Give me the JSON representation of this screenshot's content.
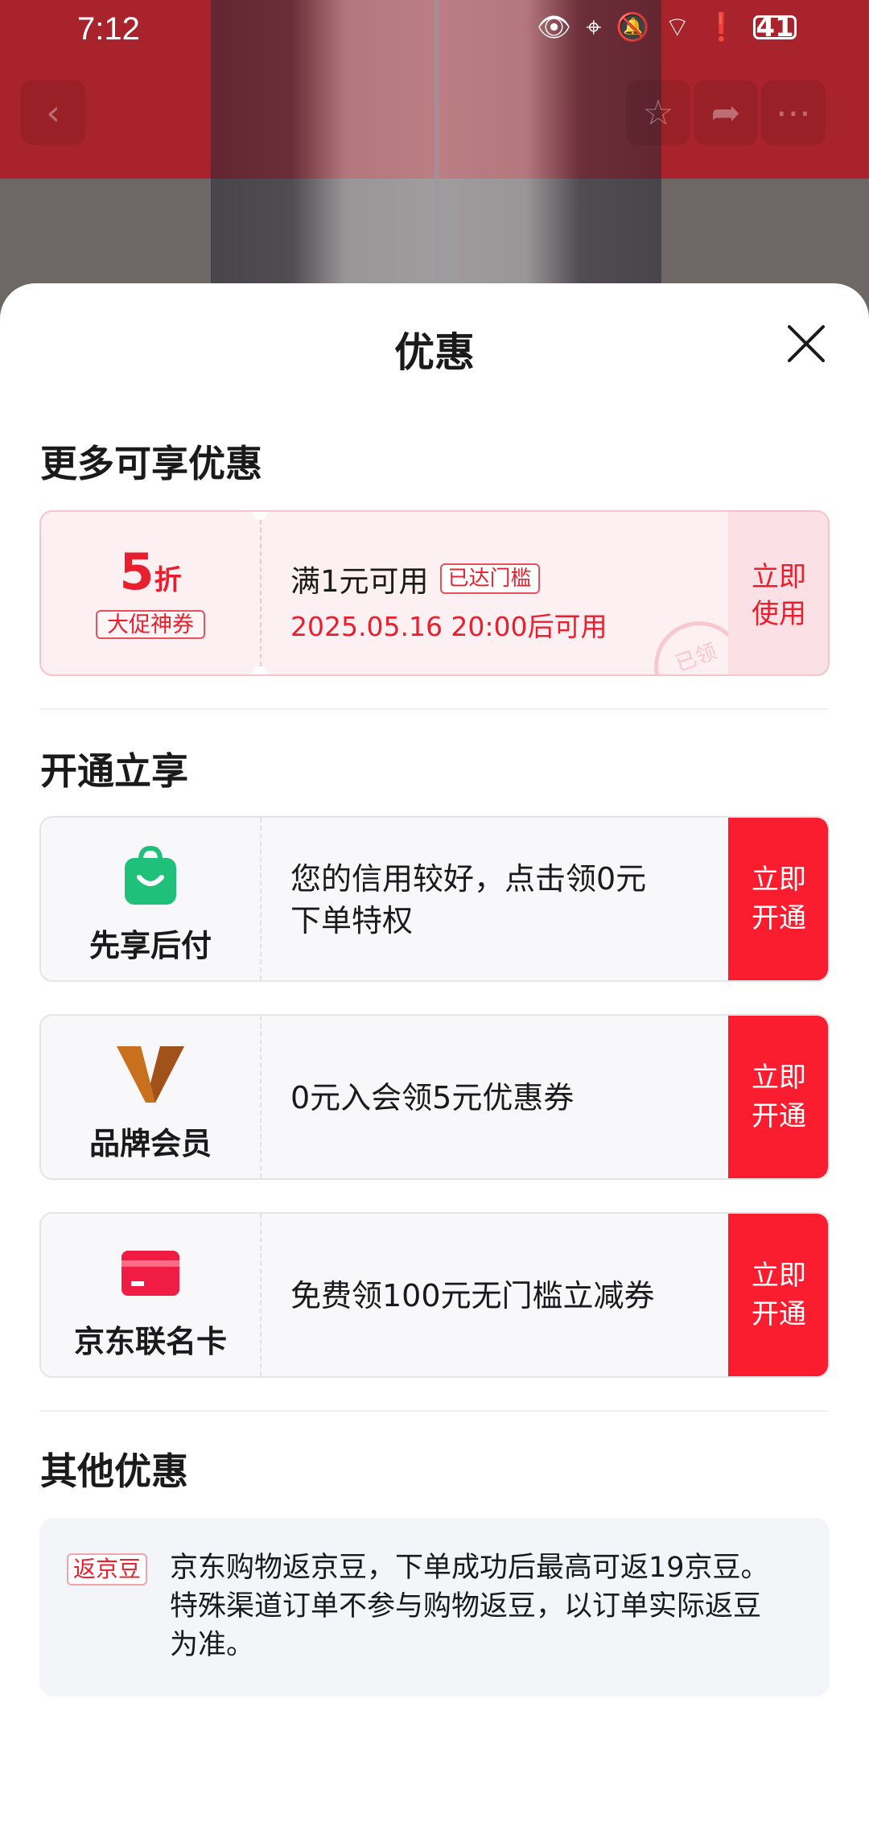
{
  "status_bar": {
    "time": "7:12",
    "battery": "41",
    "icons": [
      "eye-icon",
      "location-icon",
      "bell-off-icon",
      "wifi-icon",
      "alert-icon",
      "battery-icon"
    ]
  },
  "sheet": {
    "title": "优惠",
    "close_icon": "close-icon"
  },
  "section_more": {
    "title": "更多可享优惠",
    "coupon": {
      "value": "5",
      "unit": "折",
      "tag": "大促神券",
      "condition": "满1元可用",
      "badge": "已达门槛",
      "date": "2025.05.16 20:00后可用",
      "action_line1": "立即",
      "action_line2": "使用",
      "stamp": "已领",
      "accent_color": "#e8202e"
    }
  },
  "section_open": {
    "title": "开通立享",
    "items": [
      {
        "name": "先享后付",
        "icon": "shopping-bag-icon",
        "desc_line1": "您的信用较好，点击领0元",
        "desc_line2": "下单特权",
        "btn_line1": "立即",
        "btn_line2": "开通"
      },
      {
        "name": "品牌会员",
        "icon": "brand-v-icon",
        "desc_line1": "0元入会领5元优惠券",
        "btn_line1": "立即",
        "btn_line2": "开通"
      },
      {
        "name": "京东联名卡",
        "icon": "credit-card-icon",
        "desc_line1": "免费领100元无门槛立减券",
        "btn_line1": "立即",
        "btn_line2": "开通"
      }
    ],
    "button_color": "#fa1d30"
  },
  "section_other": {
    "title": "其他优惠",
    "tag": "返京豆",
    "text": "京东购物返京豆，下单成功后最高可返19京豆。特殊渠道订单不参与购物返豆，以订单实际返豆为准。"
  }
}
